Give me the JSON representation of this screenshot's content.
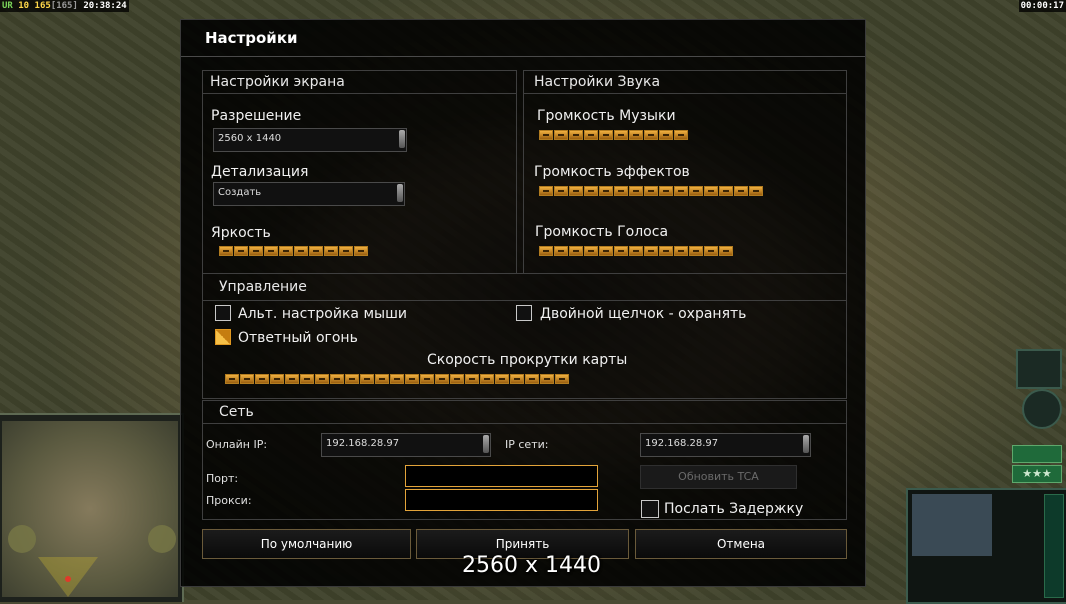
{
  "hud": {
    "ur_label": "UR",
    "ur_level": "10",
    "count": "165",
    "count_bracket": "[165]",
    "clock_left": "20:38:24",
    "clock_right": "00:00:17"
  },
  "dialog": {
    "title": "Настройки",
    "screen": {
      "title": "Настройки экрана",
      "resolution_label": "Разрешение",
      "resolution_value": "2560 x 1440",
      "detail_label": "Детализация",
      "detail_value": "Создать",
      "brightness_label": "Яркость",
      "brightness_level": 10,
      "brightness_segments": 10
    },
    "sound": {
      "title": "Настройки Звука",
      "music_label": "Громкость Музыки",
      "music_level": 10,
      "music_segments": 10,
      "effects_label": "Громкость эффектов",
      "effects_level": 15,
      "effects_segments": 15,
      "voice_label": "Громкость Голоса",
      "voice_level": 13,
      "voice_segments": 13
    },
    "controls": {
      "title": "Управление",
      "alt_mouse_label": "Альт. настройка мыши",
      "alt_mouse_checked": false,
      "double_click_label": "Двойной щелчок - охранять",
      "double_click_checked": false,
      "return_fire_label": "Ответный огонь",
      "return_fire_checked": true,
      "scroll_label": "Скорость прокрутки карты",
      "scroll_level": 23,
      "scroll_segments": 23
    },
    "network": {
      "title": "Сеть",
      "online_ip_label": "Онлайн IP:",
      "online_ip_value": "192.168.28.97",
      "network_ip_label": "IP сети:",
      "network_ip_value": "192.168.28.97",
      "port_label": "Порт:",
      "port_value": "",
      "proxy_label": "Прокси:",
      "proxy_value": "",
      "update_tca_label": "Обновить TCA",
      "send_delay_label": "Послать Задержку",
      "send_delay_checked": false
    },
    "buttons": {
      "defaults": "По умолчанию",
      "accept": "Принять",
      "cancel": "Отмена"
    }
  },
  "tooltip": "2560 x 1440",
  "colors": {
    "accent": "#e3a43a",
    "slider_fill": "#f0b040",
    "panel_bg": "#000000"
  }
}
